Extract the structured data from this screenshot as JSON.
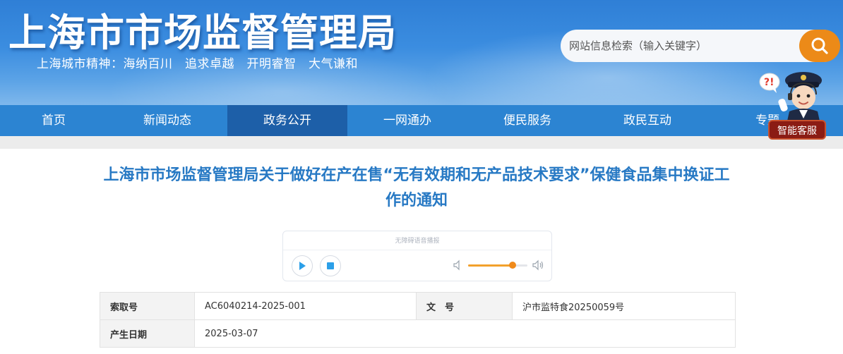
{
  "header": {
    "site_title": "上海市市场监督管理局",
    "slogan": "上海城市精神：海纳百川　追求卓越　开明睿智　大气谦和",
    "search": {
      "placeholder": "网站信息检索（输入关键字）"
    }
  },
  "nav": {
    "items": [
      {
        "label": "首页"
      },
      {
        "label": "新闻动态"
      },
      {
        "label": "政务公开",
        "active": true
      },
      {
        "label": "一网通办"
      },
      {
        "label": "便民服务"
      },
      {
        "label": "政民互动"
      },
      {
        "label": "专题"
      }
    ]
  },
  "assistant": {
    "label": "智能客服",
    "bubble": "?!"
  },
  "article": {
    "title": "上海市市场监督管理局关于做好在产在售“无有效期和无产品技术要求”保健食品集中换证工作的通知"
  },
  "player": {
    "caption": "无障碍语音播报",
    "volume": 0.75
  },
  "meta": {
    "rows": [
      [
        {
          "key": "索取号",
          "value": "AC6040214-2025-001"
        },
        {
          "key": "文　号",
          "value": "沪市监特食20250059号"
        }
      ],
      [
        {
          "key": "产生日期",
          "value": "2025-03-07"
        }
      ]
    ]
  },
  "colors": {
    "banner": "#3b8de0",
    "nav": "#2c84d2",
    "nav_active": "#1d5fa8",
    "title": "#2779c4",
    "search_button": "#ec8a18"
  }
}
